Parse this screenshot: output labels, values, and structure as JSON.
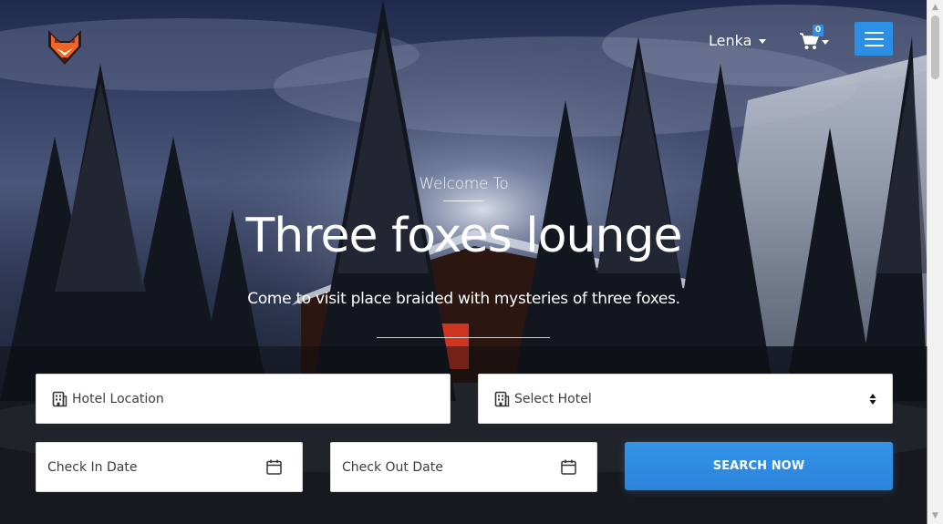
{
  "header": {
    "user_name": "Lenka",
    "cart_count": "0"
  },
  "hero": {
    "kicker": "Welcome To",
    "title": "Three foxes lounge",
    "subtitle": "Come to visit place braided with mysteries of three foxes."
  },
  "search": {
    "location_placeholder": "Hotel Location",
    "hotel_select_value": "Select Hotel",
    "checkin_placeholder": "Check In Date",
    "checkout_placeholder": "Check Out Date",
    "button_label": "SEARCH NOW"
  },
  "colors": {
    "accent": "#2c8fe6",
    "logo_orange": "#f26522"
  },
  "icons": [
    "fox-logo",
    "caret-down-icon",
    "cart-icon",
    "hamburger-icon",
    "building-icon",
    "calendar-icon",
    "select-arrows-icon"
  ]
}
